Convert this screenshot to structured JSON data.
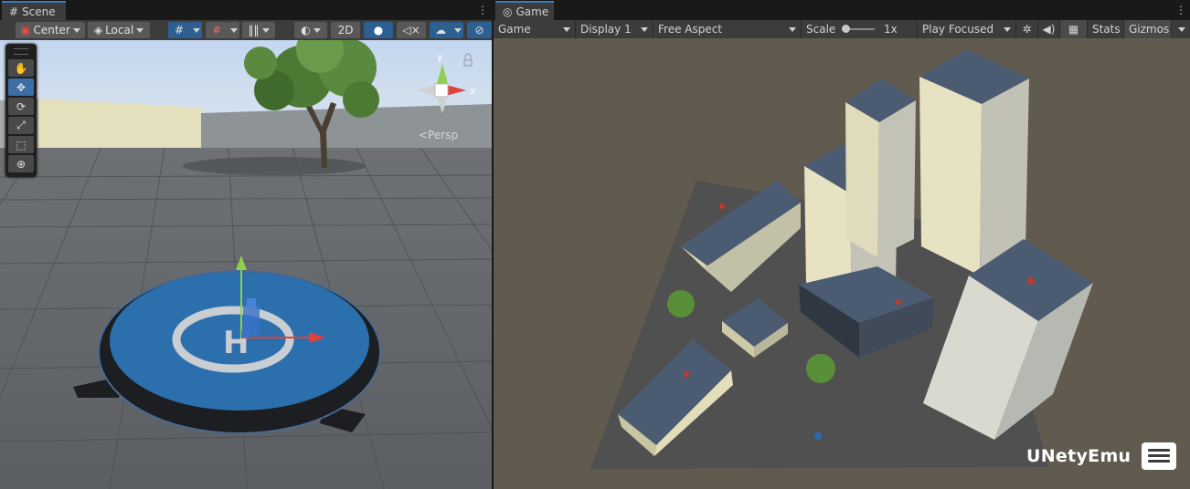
{
  "scene": {
    "tab_label": "Scene",
    "toolbar": {
      "pivot": "Center",
      "space": "Local",
      "mode_2d": "2D"
    },
    "gizmo_axes": {
      "y": "y",
      "x": "x"
    },
    "projection_label": "Persp",
    "tools": [
      "hand-tool",
      "move-tool",
      "rotate-tool",
      "scale-tool",
      "rect-tool",
      "transform-tool"
    ],
    "active_tool": "move-tool"
  },
  "game": {
    "tab_label": "Game",
    "toolbar": {
      "view_mode": "Game",
      "display": "Display 1",
      "aspect": "Free Aspect",
      "scale_label": "Scale",
      "scale_value": "1x",
      "play_mode": "Play Focused",
      "stats": "Stats",
      "gizmos": "Gizmos"
    }
  },
  "watermark": {
    "text": "UNetyEmu"
  },
  "colors": {
    "accent": "#3a79bb",
    "panel_bg": "#282828",
    "toolbar_bg": "#3c3c3c",
    "game_bg": "#605a4f",
    "ground": "#505050",
    "building_wall": "#e6e0bf",
    "building_roof": "#4a5a6e",
    "helipad_blue": "#2c6fad"
  }
}
